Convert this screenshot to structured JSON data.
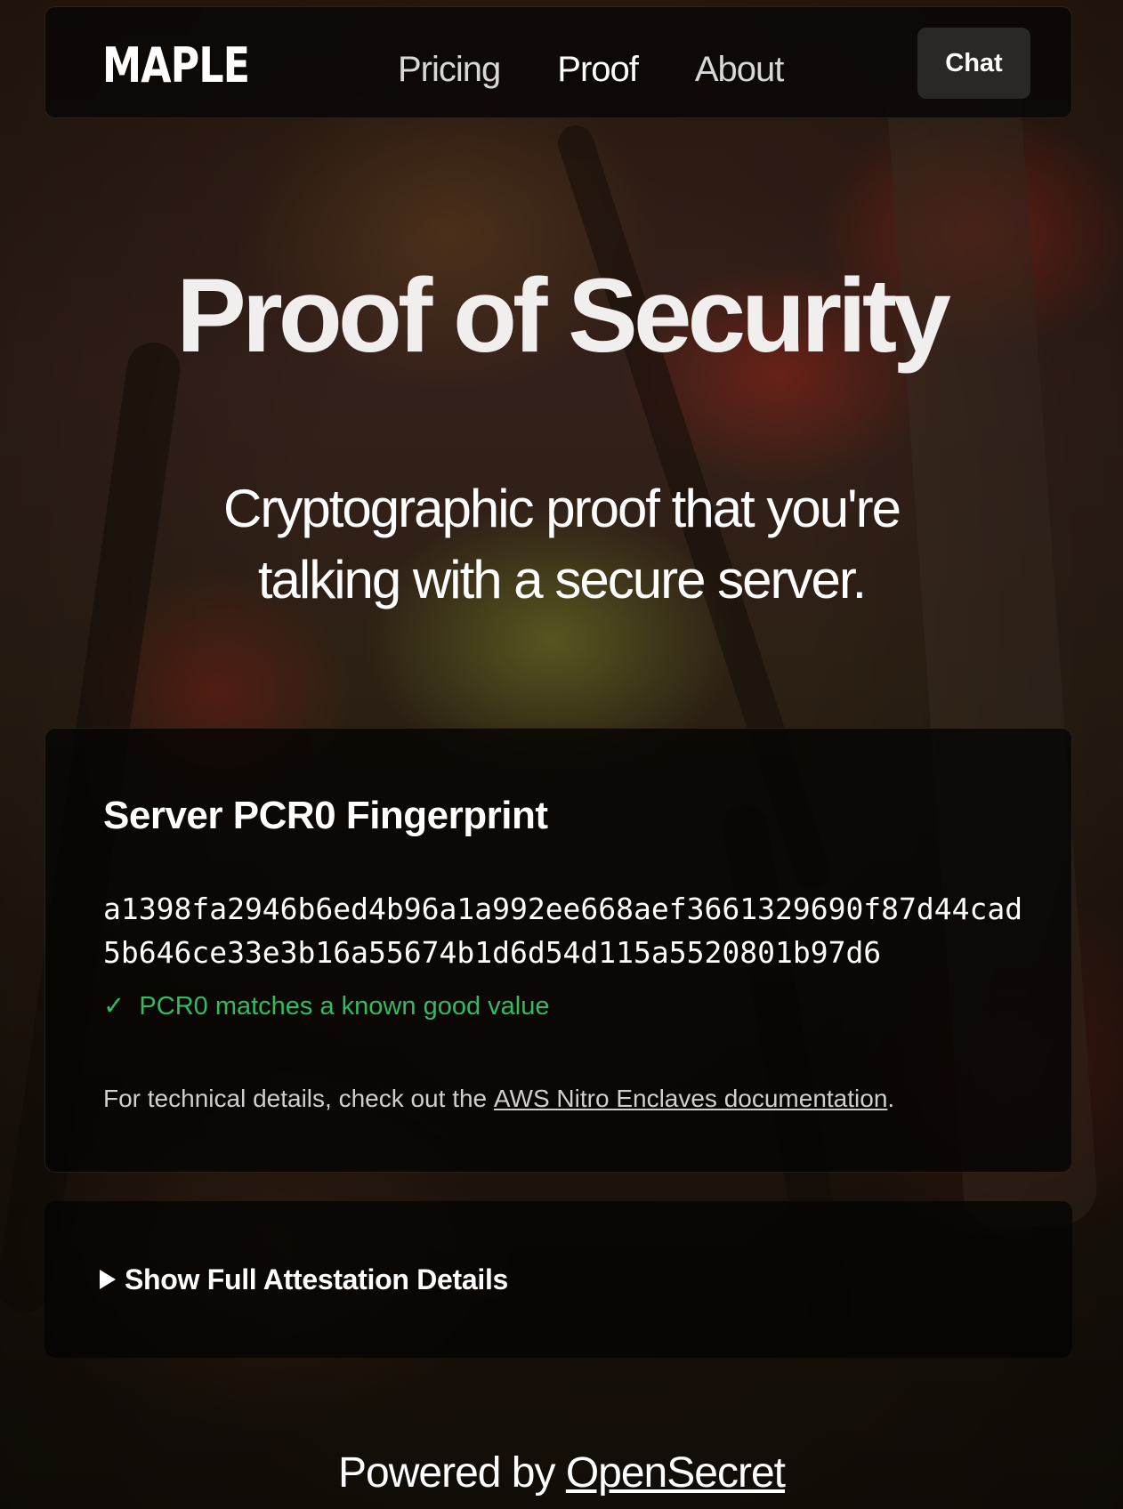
{
  "header": {
    "logo": "MAPLE",
    "nav": [
      {
        "label": "Pricing",
        "active": false
      },
      {
        "label": "Proof",
        "active": true
      },
      {
        "label": "About",
        "active": false
      }
    ],
    "chat_label": "Chat"
  },
  "hero": {
    "title": "Proof of Security",
    "subtitle": "Cryptographic proof that you're talking with a secure server."
  },
  "fingerprint_card": {
    "title": "Server PCR0 Fingerprint",
    "hash": "a1398fa2946b6ed4b96a1a992ee668aef3661329690f87d44cad5b646ce33e3b16a55674b1d6d54d115a5520801b97d6",
    "status_icon": "check-icon",
    "status_mark": "✓",
    "status_text": "PCR0 matches a known good value",
    "status_color": "#2fbd5f",
    "details_prefix": "For technical details, check out the ",
    "details_link": "AWS Nitro Enclaves documentation",
    "details_suffix": "."
  },
  "attestation": {
    "toggle_icon": "triangle-right-icon",
    "toggle_label": "Show Full Attestation Details"
  },
  "footer": {
    "prefix": "Powered by ",
    "link": "OpenSecret"
  }
}
